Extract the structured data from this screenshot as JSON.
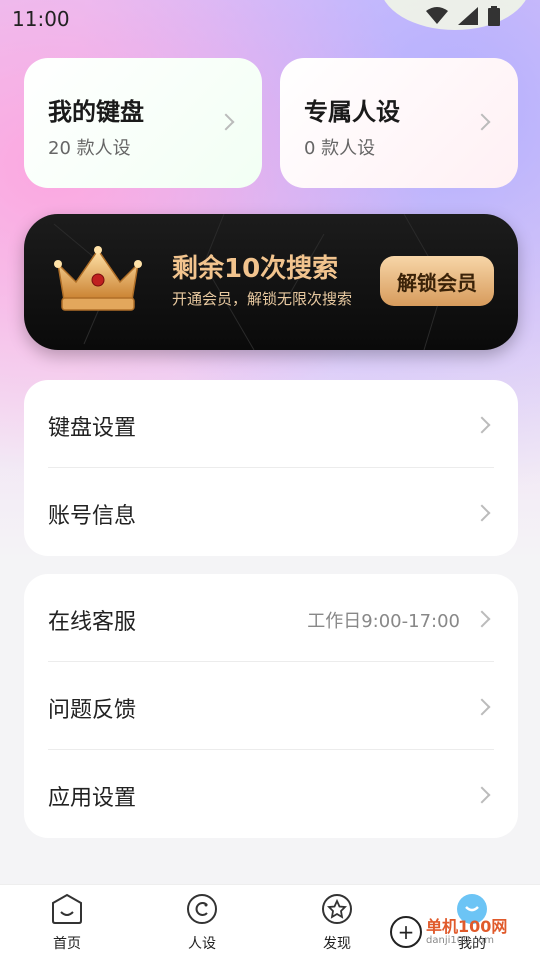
{
  "status_bar": {
    "time": "11:00"
  },
  "top_cards": [
    {
      "title": "我的键盘",
      "subtitle": "20 款人设"
    },
    {
      "title": "专属人设",
      "subtitle": "0 款人设"
    }
  ],
  "banner": {
    "title": "剩余10次搜索",
    "subtitle": "开通会员，解锁无限次搜索",
    "button": "解锁会员"
  },
  "settings_group_1": [
    {
      "label": "键盘设置"
    },
    {
      "label": "账号信息"
    }
  ],
  "settings_group_2": [
    {
      "label": "在线客服",
      "note": "工作日9:00-17:00"
    },
    {
      "label": "问题反馈"
    },
    {
      "label": "应用设置"
    }
  ],
  "nav": [
    {
      "label": "首页",
      "icon": "home-icon"
    },
    {
      "label": "人设",
      "icon": "persona-icon"
    },
    {
      "label": "发现",
      "icon": "discover-icon"
    },
    {
      "label": "我的",
      "icon": "profile-icon"
    }
  ],
  "watermark": {
    "text": "单机100网",
    "url": "danji100.com"
  }
}
